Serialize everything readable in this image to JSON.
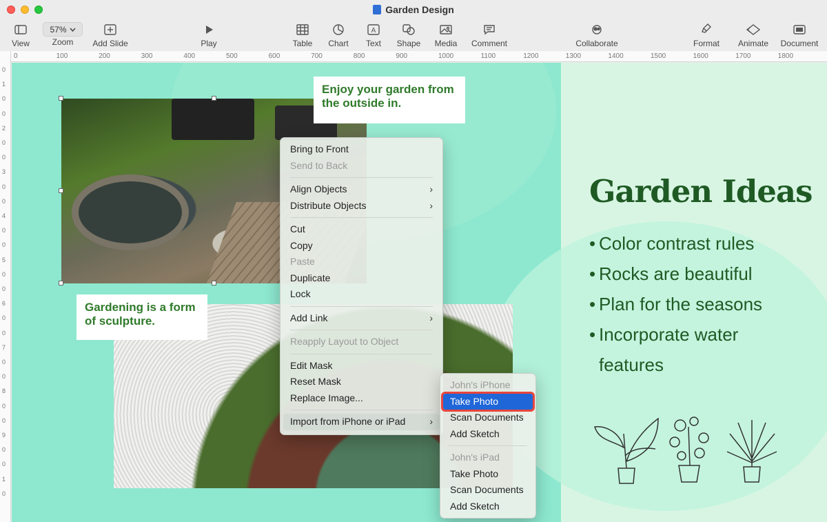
{
  "window": {
    "title": "Garden Design"
  },
  "toolbar": {
    "view": "View",
    "zoom_value": "57%",
    "zoom": "Zoom",
    "add_slide": "Add Slide",
    "play": "Play",
    "table": "Table",
    "chart": "Chart",
    "text": "Text",
    "shape": "Shape",
    "media": "Media",
    "comment": "Comment",
    "collaborate": "Collaborate",
    "format": "Format",
    "animate": "Animate",
    "document": "Document"
  },
  "ruler": {
    "top": [
      "0",
      "100",
      "200",
      "300",
      "400",
      "500",
      "600",
      "700",
      "800",
      "900",
      "1000",
      "1100",
      "1200",
      "1300",
      "1400",
      "1500",
      "1600",
      "1700",
      "1800"
    ],
    "left": [
      "0",
      "1",
      "0",
      "0",
      "2",
      "0",
      "0",
      "3",
      "0",
      "0",
      "4",
      "0",
      "0",
      "5",
      "0",
      "0",
      "6",
      "0",
      "0",
      "7",
      "0",
      "0",
      "8",
      "0",
      "0",
      "9",
      "0",
      "0",
      "1",
      "0"
    ]
  },
  "slide": {
    "callout1": "Enjoy your garden from the outside in.",
    "callout2": "Gardening is a form of sculpture.",
    "title": "Garden Ideas",
    "bullets": [
      "Color contrast rules",
      "Rocks are beautiful",
      "Plan for the seasons",
      "Incorporate water"
    ],
    "bullet4_cont": "features"
  },
  "context_menu": {
    "bring_to_front": "Bring to Front",
    "send_to_back": "Send to Back",
    "align_objects": "Align Objects",
    "distribute_objects": "Distribute Objects",
    "cut": "Cut",
    "copy": "Copy",
    "paste": "Paste",
    "duplicate": "Duplicate",
    "lock": "Lock",
    "add_link": "Add Link",
    "reapply_layout": "Reapply Layout to Object",
    "edit_mask": "Edit Mask",
    "reset_mask": "Reset Mask",
    "replace_image": "Replace Image...",
    "import_from": "Import from iPhone or iPad"
  },
  "submenu": {
    "iphone_header": "John's iPhone",
    "iphone_take_photo": "Take Photo",
    "iphone_scan": "Scan Documents",
    "iphone_sketch": "Add Sketch",
    "ipad_header": "John's iPad",
    "ipad_take_photo": "Take Photo",
    "ipad_scan": "Scan Documents",
    "ipad_sketch": "Add Sketch"
  },
  "colors": {
    "accent": "#1f66d8",
    "slide_bg": "#8de8cf",
    "title_green": "#1f5a24",
    "highlight_border": "#e8453c"
  }
}
